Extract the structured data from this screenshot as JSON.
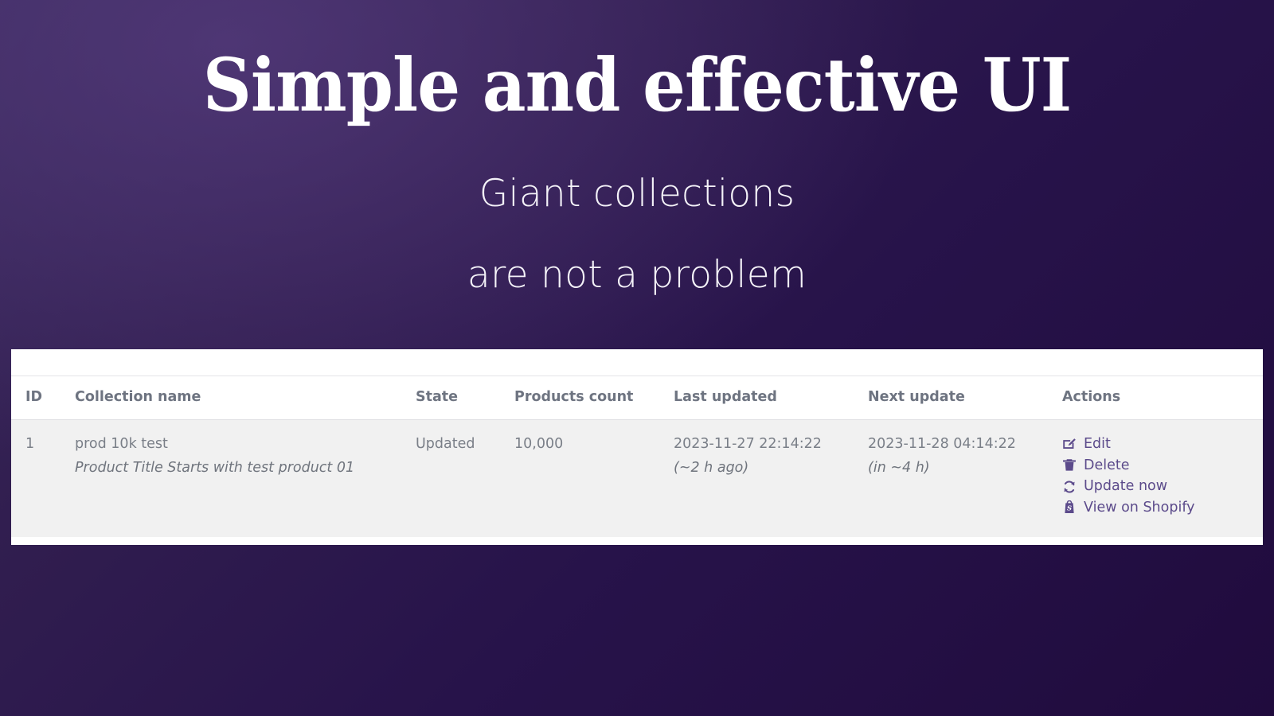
{
  "hero": {
    "title": "Simple and effective UI",
    "subtitle_line_1": "Giant collections",
    "subtitle_line_2": "are not a problem"
  },
  "theme": {
    "background_top_left": "#3a2a5d",
    "background_bottom_right": "#200b3d",
    "card_background": "#ffffff",
    "row_background": "#f1f1f1",
    "header_text": "#6e7481",
    "body_text": "#7a7f88",
    "action_link": "#5c4b8b"
  },
  "table": {
    "columns": [
      {
        "key": "id",
        "label": "ID"
      },
      {
        "key": "name",
        "label": "Collection name"
      },
      {
        "key": "state",
        "label": "State"
      },
      {
        "key": "count",
        "label": "Products count"
      },
      {
        "key": "last_updated",
        "label": "Last updated"
      },
      {
        "key": "next_update",
        "label": "Next update"
      },
      {
        "key": "actions",
        "label": "Actions"
      }
    ],
    "rows": [
      {
        "id": "1",
        "name": "prod 10k test",
        "name_rule": "Product Title Starts with test product 01",
        "state": "Updated",
        "count": "10,000",
        "last_updated": "2023-11-27 22:14:22",
        "last_updated_relative": "(~2 h ago)",
        "next_update": "2023-11-28 04:14:22",
        "next_update_relative": "(in ~4 h)",
        "actions": [
          {
            "icon": "pencil-square-icon",
            "label": "Edit"
          },
          {
            "icon": "trash-icon",
            "label": "Delete"
          },
          {
            "icon": "refresh-icon",
            "label": "Update now"
          },
          {
            "icon": "shopify-bag-icon",
            "label": "View on Shopify"
          }
        ]
      }
    ]
  }
}
